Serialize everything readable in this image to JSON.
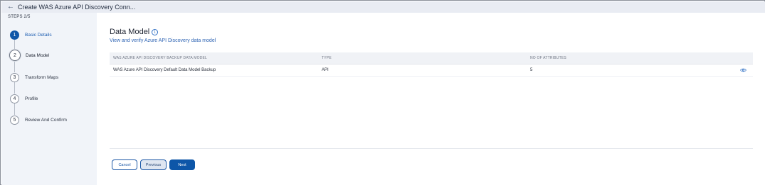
{
  "titlebar": {
    "back_glyph": "←",
    "title": "Create WAS Azure API Discovery Conn..."
  },
  "sidebar": {
    "steps_label": "STEPS 2/5",
    "steps": [
      {
        "number": "1",
        "label": "Basic Details",
        "state": "done"
      },
      {
        "number": "2",
        "label": "Data Model",
        "state": "active"
      },
      {
        "number": "3",
        "label": "Transform Maps",
        "state": "pending"
      },
      {
        "number": "4",
        "label": "Profile",
        "state": "pending"
      },
      {
        "number": "5",
        "label": "Review And Confirm",
        "state": "pending"
      }
    ]
  },
  "main": {
    "title": "Data Model",
    "info_icon": "info-icon",
    "subtitle": "View and verify Azure API Discovery data model",
    "table": {
      "headers": [
        "WAS AZURE API DISCOVERY BACKUP DATA MODEL",
        "TYPE",
        "NO OF ATTRIBUTES"
      ],
      "rows": [
        {
          "name": "WAS Azure API Discovery Default Data Model Backup",
          "type": "API",
          "attributes": "5",
          "action_icon": "eye-icon"
        }
      ]
    },
    "buttons": {
      "cancel": "Cancel",
      "previous": "Previous",
      "next": "Next"
    }
  },
  "colors": {
    "accent": "#0d56a8",
    "sidebar_bg": "#f1f4f9",
    "link": "#2d63b3"
  }
}
